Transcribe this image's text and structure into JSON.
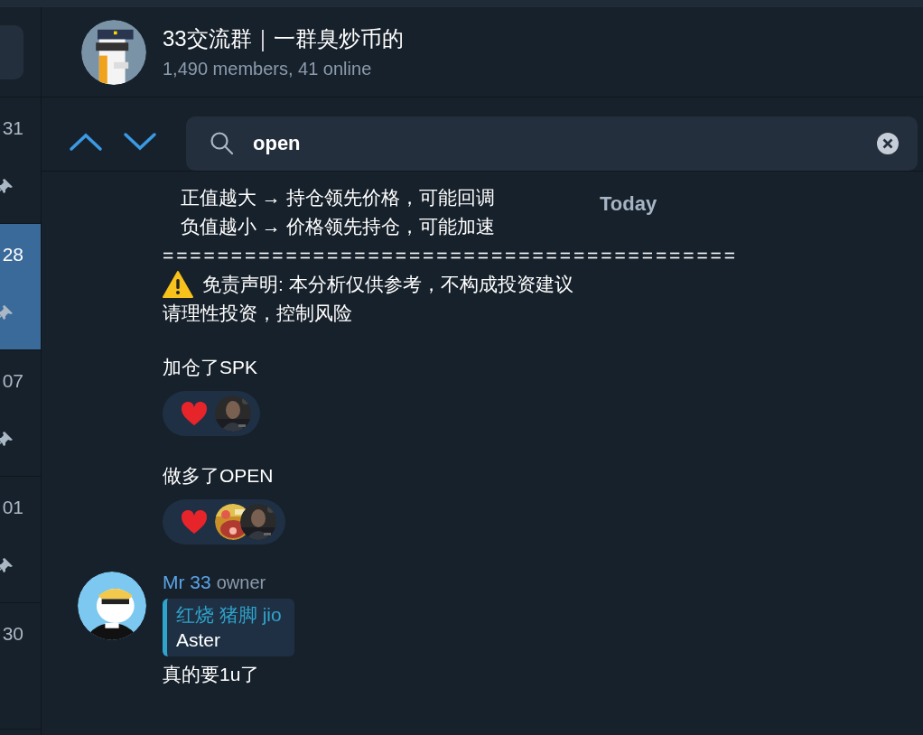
{
  "sidebar": {
    "items": [
      {
        "date": "31",
        "pinned": true,
        "selected": false
      },
      {
        "date": "28",
        "pinned": true,
        "selected": true
      },
      {
        "date": "07",
        "pinned": true,
        "selected": false
      },
      {
        "date": "01",
        "pinned": true,
        "selected": false
      },
      {
        "date": "30",
        "pinned": false,
        "selected": false
      }
    ]
  },
  "header": {
    "title": "33交流群｜一群臭炒币的",
    "subtitle": "1,490 members, 41 online"
  },
  "search": {
    "value": "open"
  },
  "date_badge": "Today",
  "messages": [
    {
      "kind": "indented",
      "lines": [
        "正值越大 → 持仓领先价格，可能回调",
        "负值越小 → 价格领先持仓，可能加速"
      ]
    },
    {
      "kind": "plain",
      "lines": [
        "=========================================="
      ]
    },
    {
      "kind": "warning",
      "lines": [
        "免责声明: 本分析仅供参考，不构成投资建议",
        "请理性投资，控制风险"
      ]
    },
    {
      "kind": "plain",
      "lines": [
        "加仓了SPK"
      ],
      "reactions": [
        {
          "users": [
            {
              "kind": "picture"
            }
          ]
        }
      ]
    },
    {
      "kind": "plain",
      "lines": [
        "做多了OPEN"
      ],
      "reactions": [
        {
          "users": [
            {
              "kind": "picture"
            },
            {
              "kind": "picture"
            }
          ]
        }
      ]
    },
    {
      "kind": "author",
      "name": "Mr 33",
      "role": "owner",
      "reply": {
        "name": "红烧 猪脚 jio",
        "text": "Aster"
      },
      "lines": [
        "真的要1u了"
      ]
    }
  ]
}
